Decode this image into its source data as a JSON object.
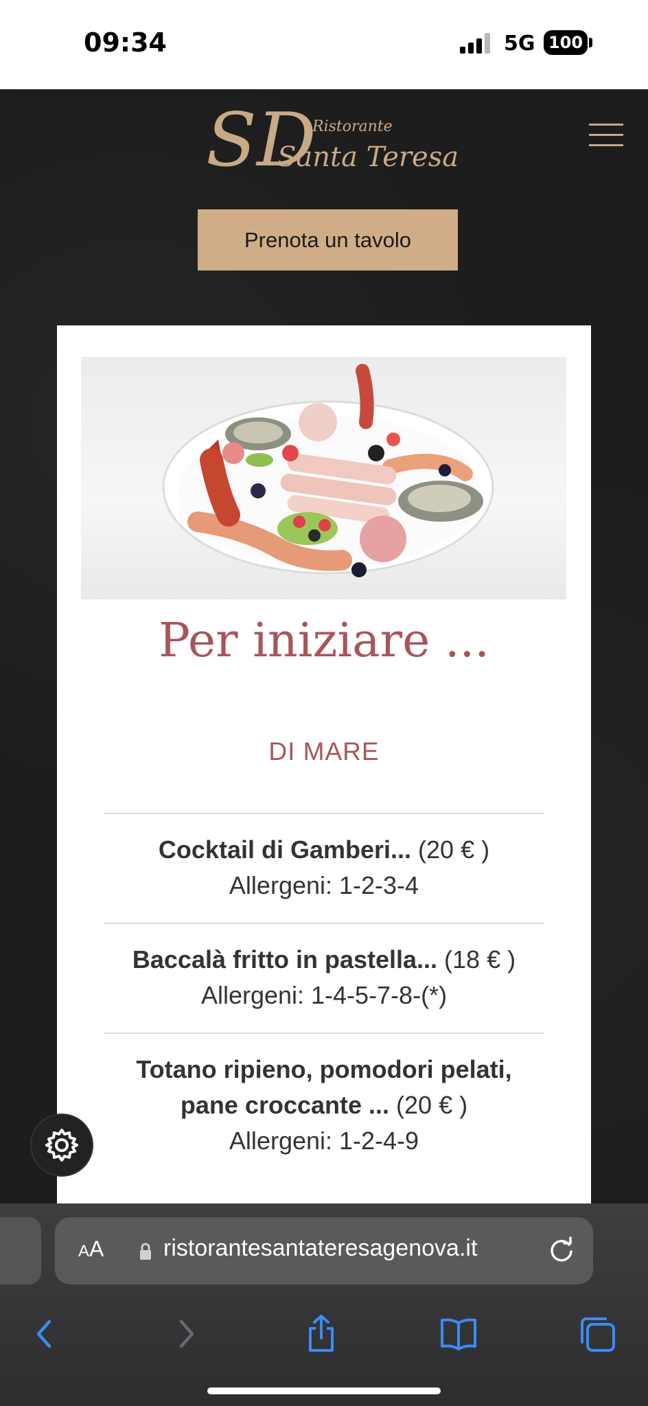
{
  "status_bar": {
    "time": "09:34",
    "network": "5G",
    "battery": "100"
  },
  "header": {
    "logo_monogram": "SD",
    "logo_small": "Ristorante",
    "logo_big": "Santa Teresa",
    "book_button": "Prenota un tavolo",
    "brand_color": "#d0ad86"
  },
  "menu": {
    "title": "Per iniziare ...",
    "subtitle": "DI MARE",
    "items": [
      {
        "name": "Cocktail di Gamberi...",
        "price": " (20 € )",
        "allergens": "Allergeni: 1-2-3-4"
      },
      {
        "name": "Baccalà fritto in pastella...",
        "price": " (18 € )",
        "allergens": "Allergeni: 1-4-5-7-8-(*)"
      },
      {
        "name": "Totano ripieno, pomodori pelati, pane croccante ...",
        "price": " (20 € )",
        "allergens": "Allergeni: 1-2-4-9"
      }
    ],
    "accent_color": "#a8555a"
  },
  "browser": {
    "aa_label_small": "A",
    "aa_label_big": "A",
    "url": "ristorantesantateresagenova.it"
  }
}
